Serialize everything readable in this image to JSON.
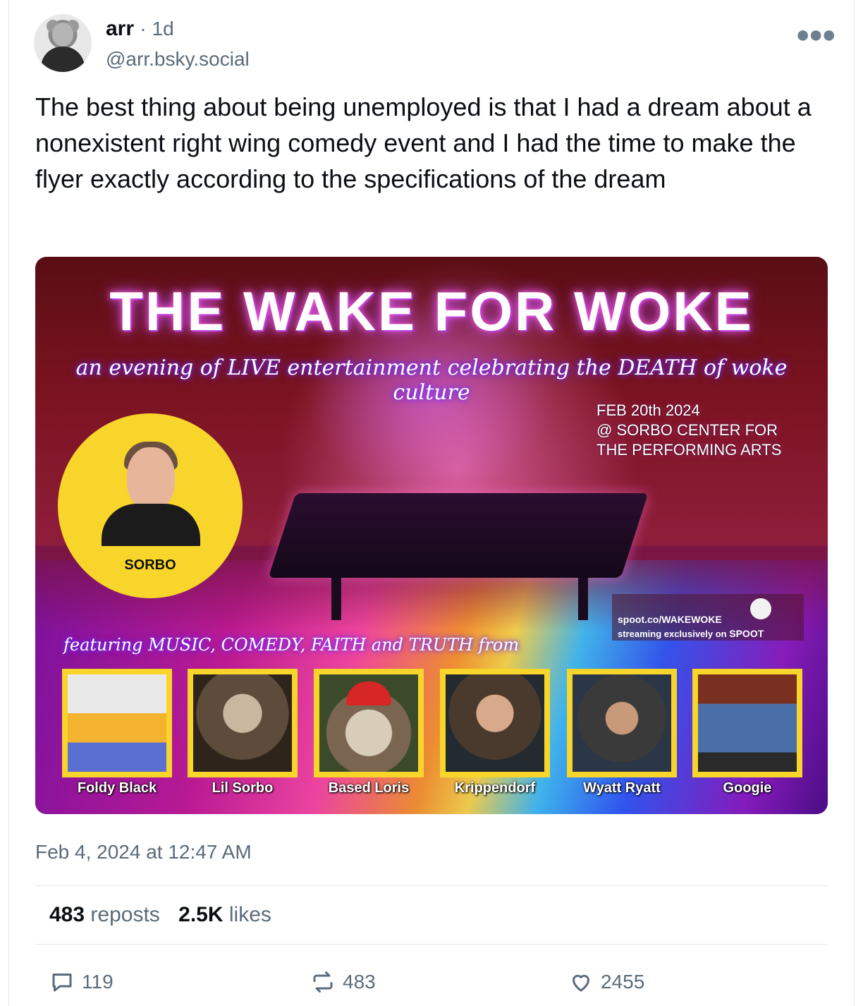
{
  "author": {
    "name": "arr",
    "separator": "·",
    "time_ago": "1d",
    "handle": "@arr.bsky.social",
    "avatar_icon": "koala-avatar-icon"
  },
  "more_icon": "more-options-icon",
  "post_text": "The best thing about being unemployed is that I had a dream about a nonexistent right wing comedy event and I had the time to make the flyer exactly according to the specifications of the dream",
  "flyer": {
    "title": "THE WAKE FOR WOKE",
    "subtitle": "an evening of LIVE entertainment celebrating the DEATH of woke culture",
    "event_info": "FEB 20th 2024\n@  SORBO CENTER FOR\nTHE PERFORMING ARTS",
    "headliner": "SORBO",
    "spoot_url": "spoot.co/WAKEWOKE",
    "spoot_line": "streaming exclusively on",
    "spoot_brand": "SPOOT",
    "featuring": "featuring MUSIC, COMEDY, FAITH and TRUTH from",
    "performers": [
      "Foldy Black",
      "Lil Sorbo",
      "Based Loris",
      "Krippendorf",
      "Wyatt Ryatt",
      "Googie"
    ]
  },
  "timestamp": "Feb 4, 2024 at 12:47 AM",
  "stats": {
    "reposts_count": "483",
    "reposts_label": "reposts",
    "likes_count": "2.5K",
    "likes_label": "likes"
  },
  "actions": {
    "reply_count": "119",
    "repost_count": "483",
    "like_count": "2455"
  },
  "colors": {
    "text_primary": "#0b0f14",
    "text_secondary": "#5b6b7b",
    "flyer_yellow": "#f8d52a"
  }
}
